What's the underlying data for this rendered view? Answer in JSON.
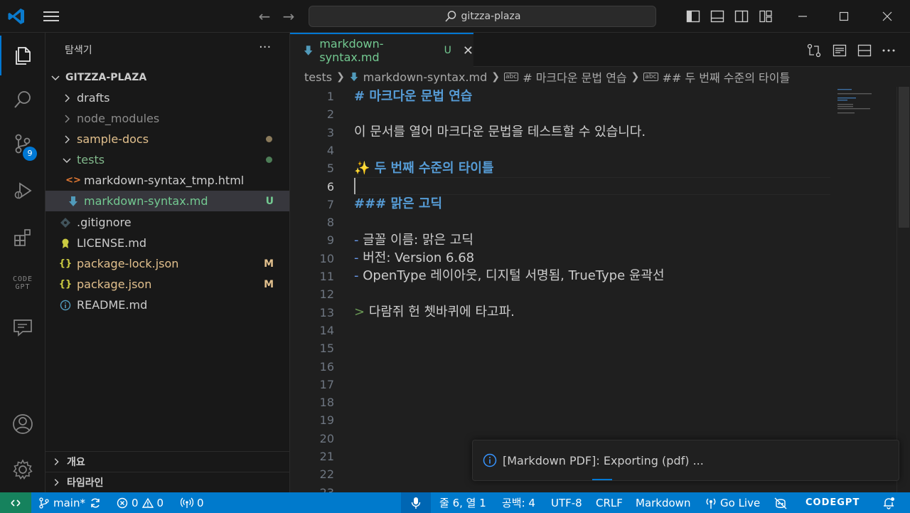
{
  "titlebar": {
    "search_text": "gitzza-plaza"
  },
  "activity_bar": {
    "source_control_badge": "9",
    "codegpt_label_line1": "CODE",
    "codegpt_label_line2": "GPT"
  },
  "sidebar": {
    "title": "탐색기",
    "more": "···",
    "root": "GITZZA-PLAZA",
    "items": [
      {
        "label": "drafts",
        "type": "folder",
        "expanded": false
      },
      {
        "label": "node_modules",
        "type": "folder",
        "expanded": false
      },
      {
        "label": "sample-docs",
        "type": "folder",
        "expanded": false
      },
      {
        "label": "tests",
        "type": "folder",
        "expanded": true
      },
      {
        "label": "markdown-syntax_tmp.html",
        "type": "file"
      },
      {
        "label": "markdown-syntax.md",
        "type": "file",
        "status": "U"
      },
      {
        "label": ".gitignore",
        "type": "file"
      },
      {
        "label": "LICENSE.md",
        "type": "file"
      },
      {
        "label": "package-lock.json",
        "type": "file",
        "status": "M"
      },
      {
        "label": "package.json",
        "type": "file",
        "status": "M"
      },
      {
        "label": "README.md",
        "type": "file"
      }
    ],
    "sections": [
      "개요",
      "타임라인"
    ]
  },
  "tab": {
    "name": "markdown-syntax.md",
    "status": "U",
    "close": "✕"
  },
  "breadcrumb": {
    "folder": "tests",
    "file": "markdown-syntax.md",
    "h1": "# 마크다운 문법 연습",
    "h2": "## 두 번째 수준의 타이틀",
    "abc": "abc"
  },
  "editor": {
    "line_numbers": [
      "1",
      "2",
      "3",
      "4",
      "5",
      "6",
      "7",
      "8",
      "9",
      "10",
      "11",
      "12",
      "13",
      "14",
      "15",
      "16",
      "17",
      "18",
      "19",
      "20",
      "21",
      "22",
      "23"
    ],
    "current_line": 6,
    "lines": {
      "l1": "# 마크다운 문법 연습",
      "l3": "이 문서를 열어 마크다운 문법을 테스트할 수 있습니다.",
      "l5_emoji": "✨",
      "l5": " 두 번째 수준의 타이틀",
      "l7": "### 맑은 고딕",
      "l9_dash": "-",
      "l9": " 글꼴 이름: 맑은 고딕",
      "l10_dash": "-",
      "l10": " 버전: Version 6.68",
      "l11_dash": "-",
      "l11": " OpenType 레이아웃, 디지털 서명됨, TrueType 윤곽선",
      "l13_quote": ">",
      "l13": " 다람쥐 헌 쳇바퀴에 타고파."
    }
  },
  "notification": {
    "text": "[Markdown PDF]: Exporting (pdf) ..."
  },
  "statusbar": {
    "branch": "main*",
    "errors": "0",
    "warnings": "0",
    "ports": "0",
    "position": "줄 6, 열 1",
    "spaces": "공백: 4",
    "encoding": "UTF-8",
    "eol": "CRLF",
    "language": "Markdown",
    "golive": "Go Live",
    "codegpt": "CODEGPT"
  },
  "colors": {
    "accent": "#0078d4",
    "statusbar": "#007acc",
    "remote": "#16825d",
    "heading": "#569cd6",
    "untracked": "#73c991",
    "modified": "#e2c08d"
  }
}
